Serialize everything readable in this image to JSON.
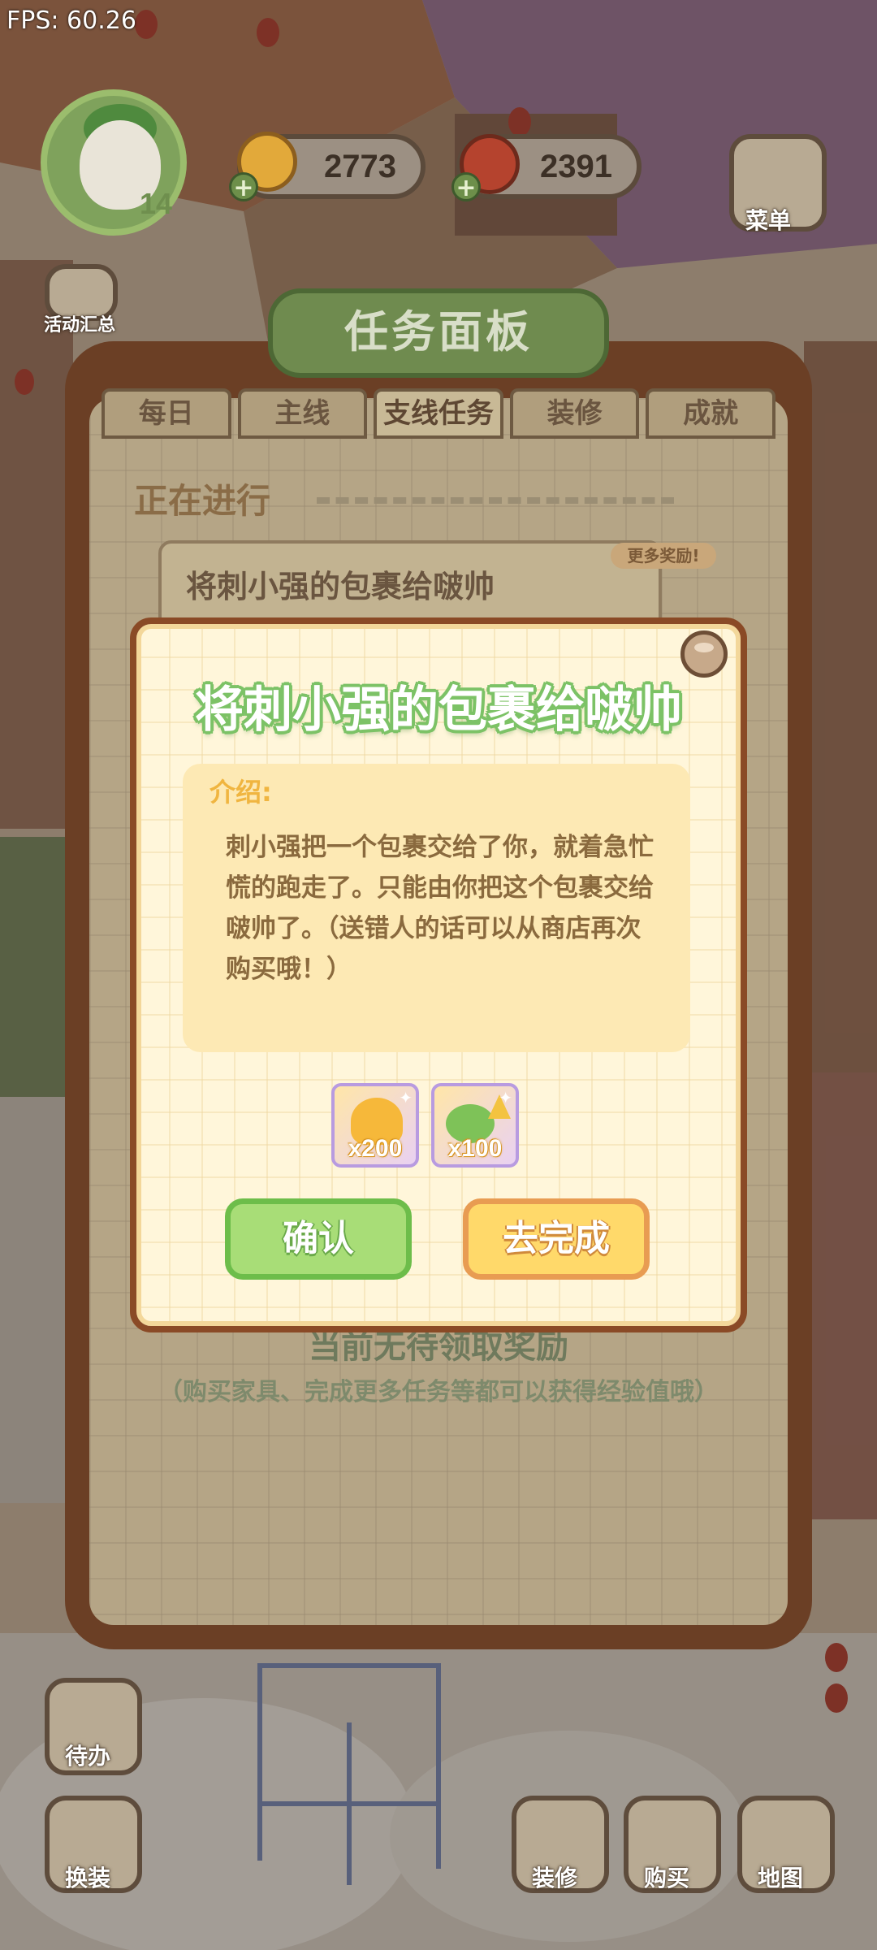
{
  "hud": {
    "fps": "FPS: 60.26",
    "level": "14",
    "coins": "2773",
    "hearts": "2391"
  },
  "side_menu": {
    "left": [
      "活动汇总",
      "待办",
      "换装"
    ],
    "right": [
      "菜单",
      "装修",
      "购买",
      "地图"
    ]
  },
  "board": {
    "title": "任务面板",
    "tabs": [
      "每日",
      "主线",
      "支线任务",
      "装修",
      "成就"
    ],
    "active_tab": "支线任务",
    "section": "正在进行",
    "task_card_title": "将刺小强的包裹给啵帅",
    "more_rewards": "更多奖励!",
    "empty_title": "当前无待领取奖励",
    "empty_sub": "（购买家具、完成更多任务等都可以获得经验值哦）"
  },
  "dialog": {
    "title": "将刺小强的包裹给啵帅",
    "intro_label": "介绍:",
    "intro_text": "刺小强把一个包裹交给了你，就着急忙慌的跑走了。只能由你把这个包裹交给啵帅了。（送错人的话可以从商店再次购买哦！）",
    "rewards": [
      {
        "icon": "gold-coins-icon",
        "qty": "x200"
      },
      {
        "icon": "exp-leaves-icon",
        "qty": "x100"
      }
    ],
    "confirm_label": "确认",
    "go_label": "去完成"
  },
  "colors": {
    "dialog_bg": "#fff6da",
    "title_green": "#7cc266",
    "confirm_green": "#a8dd77",
    "go_yellow": "#ffd96a",
    "board_brown": "#6b3f25"
  }
}
